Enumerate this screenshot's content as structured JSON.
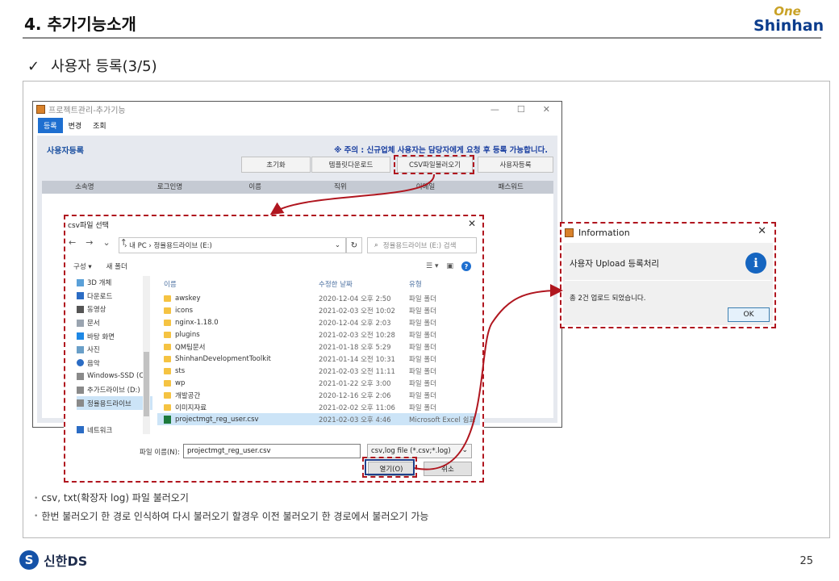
{
  "slide": {
    "title": "4. 추가기능소개",
    "logo_one": "One",
    "logo_shinhan": "Shinhan",
    "subtitle_check": "✓",
    "subtitle": "사용자 등록(3/5)",
    "page_number": "25",
    "footer_brand": "신한DS",
    "footer_mark": "S"
  },
  "app": {
    "title": "프로젝트관리-추가기능",
    "window_controls": [
      "—",
      "☐",
      "✕"
    ],
    "menu": [
      "등록",
      "변경",
      "조회"
    ],
    "heading": "사용자등록",
    "notice": "※ 주의 : 신규업체 사용자는 담당자에게 요청 후 등록 가능합니다.",
    "buttons": [
      "초기화",
      "템플릿다운로드",
      "CSV파일불러오기",
      "사용자등록"
    ],
    "grid_columns": [
      "소속명",
      "로그인명",
      "이름",
      "직위",
      "이메일",
      "패스워드"
    ]
  },
  "file_dialog": {
    "title": "csv파일 선택",
    "close": "✕",
    "nav": [
      "←",
      "→",
      "⌄",
      "↑"
    ],
    "address": "›  내 PC  ›  정율용드라이브 (E:)",
    "address_chevron": "⌄",
    "refresh": "↻",
    "search_placeholder": "정율용드라이브 (E:) 검색",
    "toolbar": [
      "구성 ▾",
      "새 폴더"
    ],
    "view_icons": [
      "☰ ▾",
      "▣"
    ],
    "help": "?",
    "nav_items": [
      "3D 개체",
      "다운로드",
      "동영상",
      "문서",
      "바탕 화면",
      "사진",
      "음악",
      "Windows-SSD (C:)",
      "추가드라이브 (D:)",
      "정율용드라이브",
      "",
      "네트워크"
    ],
    "columns": [
      "이름",
      "수정한 날짜",
      "유형"
    ],
    "files": [
      {
        "name": "awskey",
        "date": "2020-12-04 오후 2:50",
        "type": "파일 폴더"
      },
      {
        "name": "icons",
        "date": "2021-02-03 오전 10:02",
        "type": "파일 폴더"
      },
      {
        "name": "nginx-1.18.0",
        "date": "2020-12-04 오후 2:03",
        "type": "파일 폴더"
      },
      {
        "name": "plugins",
        "date": "2021-02-03 오전 10:28",
        "type": "파일 폴더"
      },
      {
        "name": "QM팀문서",
        "date": "2021-01-18 오후 5:29",
        "type": "파일 폴더"
      },
      {
        "name": "ShinhanDevelopmentToolkit",
        "date": "2021-01-14 오전 10:31",
        "type": "파일 폴더"
      },
      {
        "name": "sts",
        "date": "2021-02-03 오전 11:11",
        "type": "파일 폴더"
      },
      {
        "name": "wp",
        "date": "2021-01-22 오후 3:00",
        "type": "파일 폴더"
      },
      {
        "name": "개발공간",
        "date": "2020-12-16 오후 2:06",
        "type": "파일 폴더"
      },
      {
        "name": "이미지자료",
        "date": "2021-02-02 오후 11:06",
        "type": "파일 폴더"
      },
      {
        "name": "projectmgt_reg_user.csv",
        "date": "2021-02-03 오후 4:46",
        "type": "Microsoft Excel 쉼표"
      }
    ],
    "filename_label": "파일 이름(N):",
    "filename_value": "projectmgt_reg_user.csv",
    "filetype": "csv,log file (*.csv;*.log)",
    "filetype_chevron": "⌄",
    "open": "열기(O)",
    "cancel": "취소"
  },
  "info_dialog": {
    "title": "Information",
    "close": "✕",
    "message": "사용자 Upload 등록처리",
    "icon_glyph": "i",
    "detail": "총 2건 업로드 되었습니다.",
    "ok": "OK"
  },
  "notes": [
    "csv, txt(확장자 log) 파일 불러오기",
    "한번 불러오기 한 경로 인식하여 다시 불러오기 할경우 이전 불러오기 한 경로에서 불러오기 가능"
  ],
  "notes_bullet": "•",
  "colors": {
    "highlight": "#b0161f",
    "accent": "#1e6fd0",
    "brand": "#0b3c8c"
  }
}
